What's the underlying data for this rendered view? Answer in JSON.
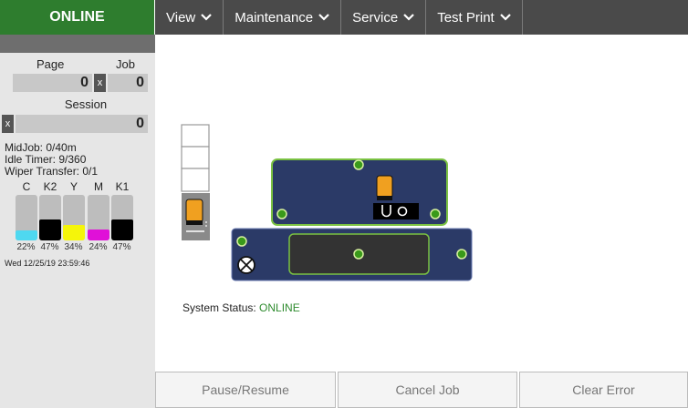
{
  "status": {
    "label": "ONLINE"
  },
  "menu": [
    {
      "label": "View"
    },
    {
      "label": "Maintenance"
    },
    {
      "label": "Service"
    },
    {
      "label": "Test Print"
    }
  ],
  "counters": {
    "page_label": "Page",
    "job_label": "Job",
    "page_value": "0",
    "job_value": "0",
    "session_label": "Session",
    "session_value": "0",
    "reset_glyph": "x"
  },
  "info": {
    "midjob": "MidJob: 0/40m",
    "idle_timer": "Idle Timer: 9/360",
    "wiper_transfer": "Wiper Transfer: 0/1"
  },
  "inks": [
    {
      "label": "C",
      "percent_text": "22%",
      "level": 0.22,
      "color": "#4fd8f0"
    },
    {
      "label": "K2",
      "percent_text": "47%",
      "level": 0.47,
      "color": "#000000"
    },
    {
      "label": "Y",
      "percent_text": "34%",
      "level": 0.34,
      "color": "#f5f50a"
    },
    {
      "label": "M",
      "percent_text": "24%",
      "level": 0.24,
      "color": "#e010d8"
    },
    {
      "label": "K1",
      "percent_text": "47%",
      "level": 0.47,
      "color": "#000000"
    }
  ],
  "timestamp": "Wed 12/25/19 23:59:46",
  "system_status": {
    "label": "System Status:",
    "value": "ONLINE"
  },
  "buttons": {
    "pause_resume": "Pause/Resume",
    "cancel_job": "Cancel Job",
    "clear_error": "Clear Error"
  },
  "colors": {
    "online_green": "#2e7d2e",
    "menubar": "#4a4a4a",
    "platen_navy": "#2b3a67",
    "cartridge_orange": "#f0a020",
    "indicator_green": "#3a9a1a"
  }
}
